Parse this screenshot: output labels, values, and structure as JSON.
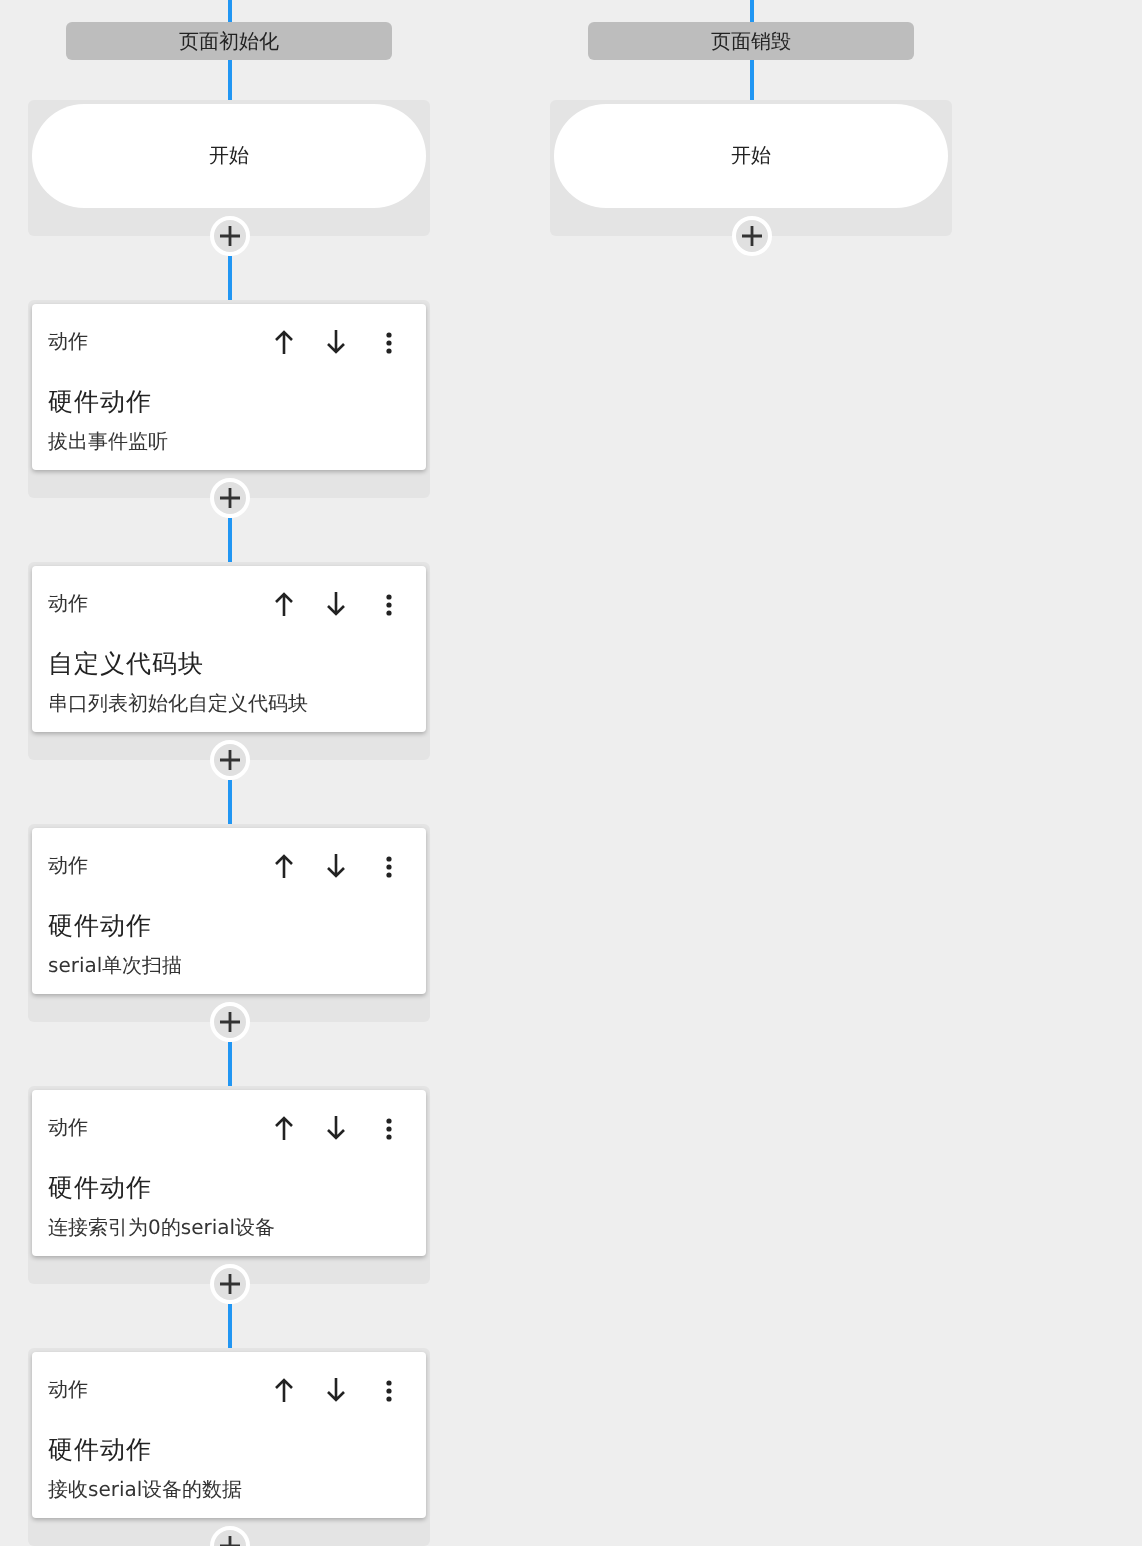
{
  "flows": [
    {
      "title": "页面初始化",
      "start_label": "开始",
      "blocks": [
        {
          "type_label": "动作",
          "title": "硬件动作",
          "subtitle": "拔出事件监听"
        },
        {
          "type_label": "动作",
          "title": "自定义代码块",
          "subtitle": "串口列表初始化自定义代码块"
        },
        {
          "type_label": "动作",
          "title": "硬件动作",
          "subtitle": "serial单次扫描"
        },
        {
          "type_label": "动作",
          "title": "硬件动作",
          "subtitle": "连接索引为0的serial设备"
        },
        {
          "type_label": "动作",
          "title": "硬件动作",
          "subtitle": "接收serial设备的数据"
        }
      ]
    },
    {
      "title": "页面销毁",
      "start_label": "开始"
    }
  ]
}
